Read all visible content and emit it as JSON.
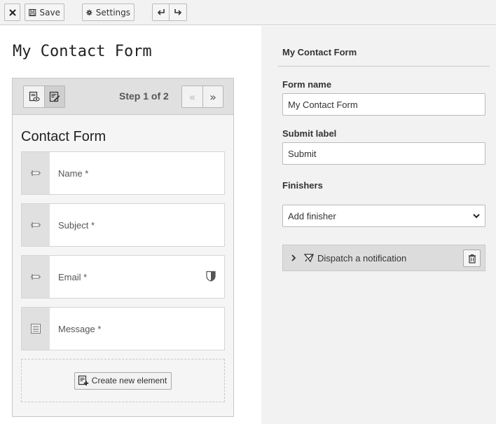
{
  "toolbar": {
    "close_icon": "close-icon",
    "save_label": "Save",
    "settings_label": "Settings",
    "undo_icon": "undo-icon",
    "redo_icon": "redo-icon"
  },
  "stage": {
    "page_title": "My Contact Form",
    "step_label": "Step 1 of 2",
    "prev_glyph": "«",
    "next_glyph": "»",
    "form_title": "Contact Form",
    "elements": [
      {
        "label": "Name *",
        "icon": "text-field-icon"
      },
      {
        "label": "Subject *",
        "icon": "text-field-icon"
      },
      {
        "label": "Email *",
        "icon": "text-field-icon",
        "badge": "shield-icon"
      },
      {
        "label": "Message *",
        "icon": "textarea-icon"
      }
    ],
    "create_label": "Create new element"
  },
  "inspector": {
    "title": "My Contact Form",
    "form_name_label": "Form name",
    "form_name_value": "My Contact Form",
    "submit_label_label": "Submit label",
    "submit_label_value": "Submit",
    "finishers_label": "Finishers",
    "add_finisher": "Add finisher",
    "finisher_item": "Dispatch a notification"
  },
  "colors": {
    "toolbar_bg": "#f2f2f2",
    "inspector_bg": "#f2f2f2",
    "element_icon_bg": "#e0e0e0",
    "finisher_bg": "#dcdcdc"
  }
}
